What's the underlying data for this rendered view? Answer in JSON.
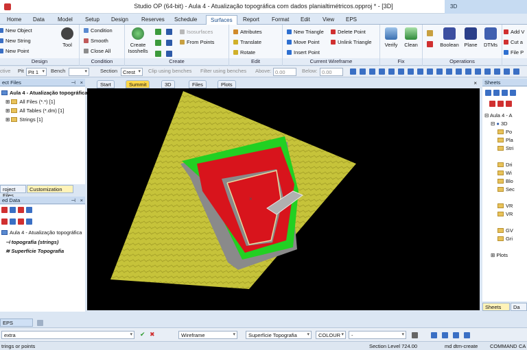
{
  "window": {
    "title": "Studio OP (64-bit) - Aula 4 - Atualização topográfica com dados planialtimétricos.opproj * - [3D]",
    "context_tab": "3D"
  },
  "menu": [
    "Home",
    "Data",
    "Model",
    "Setup",
    "Design",
    "Reserves",
    "Schedule",
    "Surfaces",
    "Report",
    "Format",
    "Edit",
    "View",
    "EPS"
  ],
  "menu_active": "Surfaces",
  "ribbon": {
    "design": {
      "label": "Design",
      "items": [
        "New Object",
        "New String",
        "New Point"
      ],
      "tool": "Tool"
    },
    "condition": {
      "label": "Condition",
      "items": [
        "Condition",
        "Smooth",
        "Close All"
      ]
    },
    "create": {
      "label": "Create",
      "isoshells": "Create Isoshells",
      "isosurfaces": "Isosurfaces",
      "from_points": "From Points"
    },
    "edit": {
      "label": "Edit",
      "items": [
        "Attributes",
        "Translate",
        "Rotate"
      ]
    },
    "wireframe": {
      "label": "Current Wireframe",
      "items": [
        "New Triangle",
        "Move Point",
        "Insert Point",
        "Delete Point",
        "Unlink Triangle"
      ]
    },
    "fix": {
      "label": "Fix",
      "items": [
        "Verify",
        "Clean"
      ]
    },
    "operations": {
      "label": "Operations",
      "items": [
        "Boolean",
        "Plane",
        "DTMs"
      ]
    },
    "extra": {
      "items": [
        "Add V",
        "Cut a",
        "File P"
      ]
    }
  },
  "toolbar2": {
    "active": "ctive",
    "pit_label": "Pit",
    "pit_value": "Pit 1",
    "bench_label": "Bench",
    "section_label": "Section",
    "section_value": "Crest",
    "clip": "Clip using benches",
    "filter": "Filter using benches",
    "above_label": "Above:",
    "above_value": "0.00",
    "below_label": "Below:",
    "below_value": "0.00"
  },
  "project_files": {
    "header": "ect Files",
    "root": "Aula 4 - Atualização topográfica",
    "items": [
      "All Files (*.*) [1]",
      "All Tables (*.dm) [1]",
      "Strings [1]"
    ],
    "tabs": [
      "roject Files",
      "Customization"
    ]
  },
  "loaded_data": {
    "header": "ed Data",
    "root": "Aula 4 - Atualização topográfica",
    "items": [
      "topografia (strings)",
      "Superfície Topografia"
    ]
  },
  "doc_tabs": [
    "Start",
    "Summit",
    "3D",
    "Files",
    "Plots"
  ],
  "doc_tab_active": "Summit",
  "sheets": {
    "header": "Sheets",
    "items": [
      "Aula 4 - A",
      "3D",
      "Po",
      "Pla",
      "Stri",
      "Dri",
      "Wi",
      "Blo",
      "Sec",
      "VR",
      "VR",
      "GV",
      "Gri",
      "Plots"
    ],
    "tabs": [
      "Sheets",
      "Da"
    ]
  },
  "bottom_tab": "EPS Sequence",
  "cmd": {
    "input": "extra",
    "mode": "Wireframe",
    "object": "Superfície Topografia",
    "colour": "COLOUR",
    "extra": "-"
  },
  "status": {
    "left": "trings or points",
    "section_level": "Section Level 724.00",
    "command": "md dtm-create",
    "mode": "COMMAND",
    "caps": "CA"
  },
  "colors": {
    "terrain": "#c6c33a",
    "pit_red": "#d8141c",
    "pit_green": "#22d022",
    "pit_grey": "#8a8a8a",
    "viewport_bg": "#000000",
    "ribbon_accent": "#1b4e8c"
  }
}
